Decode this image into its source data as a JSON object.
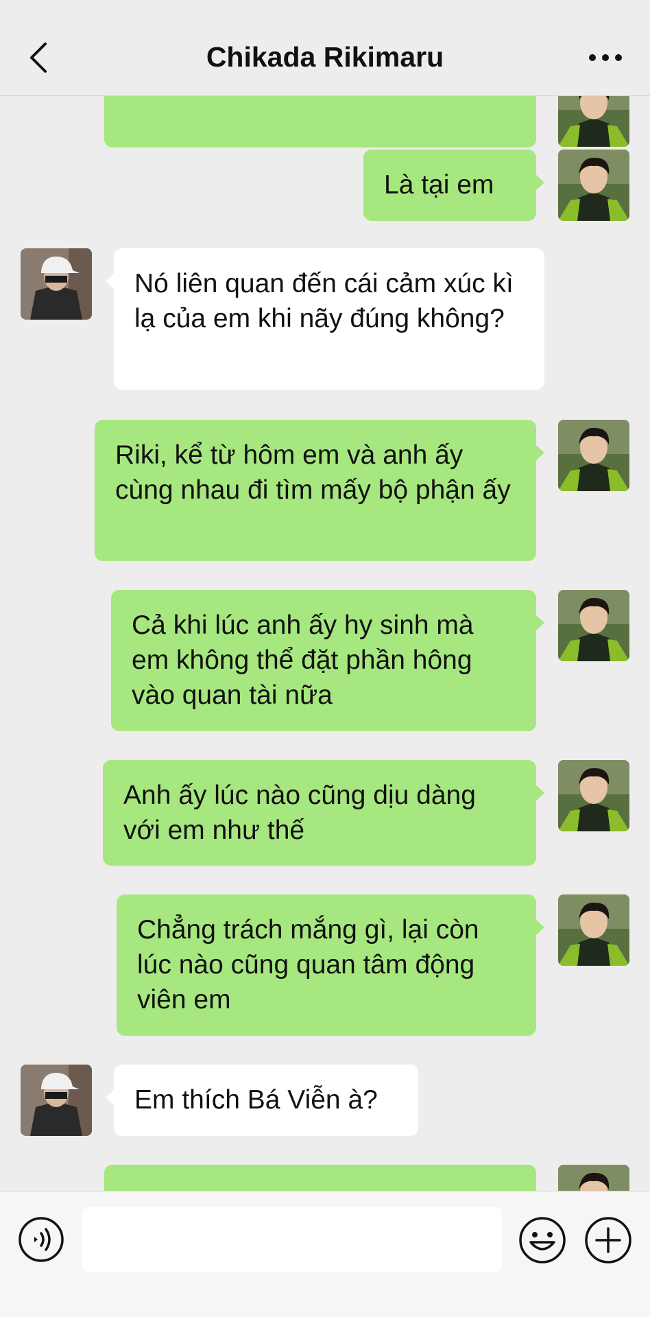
{
  "header": {
    "title": "Chikada Rikimaru"
  },
  "messages": [
    {
      "side": "me",
      "text": ""
    },
    {
      "side": "me",
      "text": "Là tại em"
    },
    {
      "side": "other",
      "text": "Nó liên quan đến cái cảm xúc kì lạ của em khi nãy đúng không?"
    },
    {
      "side": "me",
      "text": "Riki, kể từ hôm em và anh ấy cùng nhau đi tìm mấy bộ phận ấy"
    },
    {
      "side": "me",
      "text": "Cả khi lúc anh ấy hy sinh mà em không thể đặt phần hông vào quan tài nữa"
    },
    {
      "side": "me",
      "text": "Anh ấy lúc nào cũng dịu dàng với em như thế"
    },
    {
      "side": "me",
      "text": "Chẳng trách mắng gì, lại còn lúc nào cũng quan tâm động viên em"
    },
    {
      "side": "other",
      "text": "Em thích Bá Viễn à?"
    },
    {
      "side": "me",
      "text": ""
    }
  ],
  "input": {
    "value": "",
    "placeholder": ""
  },
  "colors": {
    "my_bubble": "#a7e77f",
    "other_bubble": "#ffffff",
    "background": "#ededed"
  },
  "icons": [
    "back-arrow-icon",
    "more-icon",
    "voice-icon",
    "emoji-icon",
    "plus-icon"
  ]
}
